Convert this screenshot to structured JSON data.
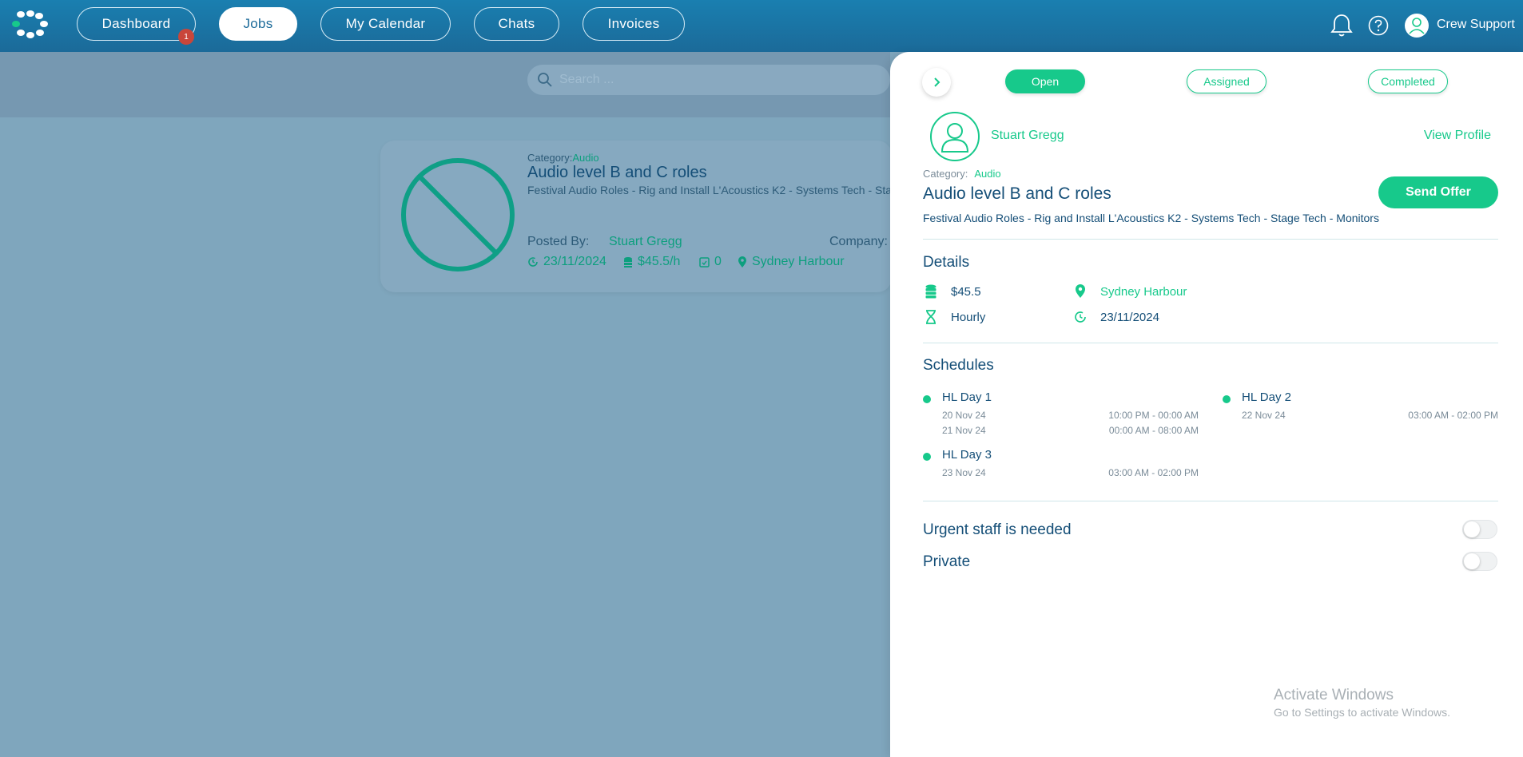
{
  "nav": {
    "items": [
      {
        "label": "Dashboard",
        "badge": "1"
      },
      {
        "label": "Jobs",
        "active": true
      },
      {
        "label": "My Calendar"
      },
      {
        "label": "Chats"
      },
      {
        "label": "Invoices"
      }
    ],
    "user_name": "Crew Support",
    "icons": [
      "bell-icon",
      "help-icon",
      "user-avatar-icon"
    ]
  },
  "search": {
    "placeholder": "Search ..."
  },
  "job_card": {
    "category_label": "Category:",
    "category": "Audio",
    "title": "Audio level B and C roles",
    "description": "Festival Audio Roles - Rig and Install L'Acoustics K2 - Systems Tech - Stage Tech - Monitors",
    "posted_by_label": "Posted By:",
    "posted_by": "Stuart Gregg",
    "company_label": "Company:",
    "date": "23/11/2024",
    "rate": "$45.5/h",
    "count": "0",
    "location": "Sydney Harbour"
  },
  "panel": {
    "statuses": [
      "Open",
      "Assigned",
      "Completed"
    ],
    "active_status": "Open",
    "poster_name": "Stuart Gregg",
    "view_profile": "View Profile",
    "category_label": "Category:",
    "category": "Audio",
    "title": "Audio level B and C roles",
    "send_offer": "Send Offer",
    "description": "Festival Audio Roles - Rig and Install L'Acoustics K2 - Systems Tech - Stage Tech - Monitors",
    "details_heading": "Details",
    "details": {
      "rate": "$45.5",
      "rate_type": "Hourly",
      "location": "Sydney Harbour",
      "date": "23/11/2024"
    },
    "schedules_heading": "Schedules",
    "schedules": [
      {
        "name": "HL Day 1",
        "lines": [
          {
            "date": "20 Nov 24",
            "time": "10:00 PM - 00:00 AM"
          },
          {
            "date": "21 Nov 24",
            "time": "00:00 AM - 08:00 AM"
          }
        ]
      },
      {
        "name": "HL Day 2",
        "lines": [
          {
            "date": "22 Nov 24",
            "time": "03:00 AM - 02:00 PM"
          }
        ]
      },
      {
        "name": "HL Day 3",
        "lines": [
          {
            "date": "23 Nov 24",
            "time": "03:00 AM - 02:00 PM"
          }
        ]
      }
    ],
    "urgent_label": "Urgent staff is needed",
    "urgent_on": false,
    "private_label": "Private",
    "private_on": false
  },
  "watermark": {
    "title": "Activate Windows",
    "subtitle": "Go to Settings to activate Windows."
  },
  "colors": {
    "accent": "#17c98b",
    "navy_text": "#144e77",
    "topbar": "#1b6a99",
    "badge": "#c9463a"
  }
}
